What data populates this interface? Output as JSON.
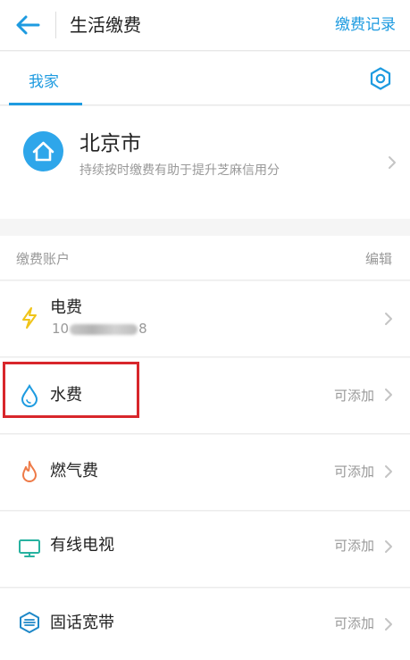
{
  "header": {
    "title": "生活缴费",
    "records_label": "缴费记录"
  },
  "tabs": [
    {
      "label": "我家",
      "active": true
    }
  ],
  "home": {
    "city": "北京市",
    "tip": "持续按时缴费有助于提升芝麻信用分"
  },
  "accounts": {
    "section_label": "缴费账户",
    "edit_label": "编辑",
    "items": [
      {
        "name": "电费",
        "account_prefix": "10",
        "account_suffix": "8",
        "icon": "lightning-icon"
      },
      {
        "name": "水费",
        "action": "可添加",
        "icon": "water-drop-icon",
        "highlighted": true
      },
      {
        "name": "燃气费",
        "action": "可添加",
        "icon": "flame-icon"
      },
      {
        "name": "有线电视",
        "action": "可添加",
        "icon": "tv-icon"
      },
      {
        "name": "固话宽带",
        "action": "可添加",
        "icon": "broadband-icon"
      }
    ]
  },
  "colors": {
    "accent": "#1e9be0",
    "highlight_border": "#d8262b",
    "electric": "#f0c419",
    "gas": "#ee7a47",
    "tv": "#27b2a0",
    "broadband": "#1e88c8"
  }
}
